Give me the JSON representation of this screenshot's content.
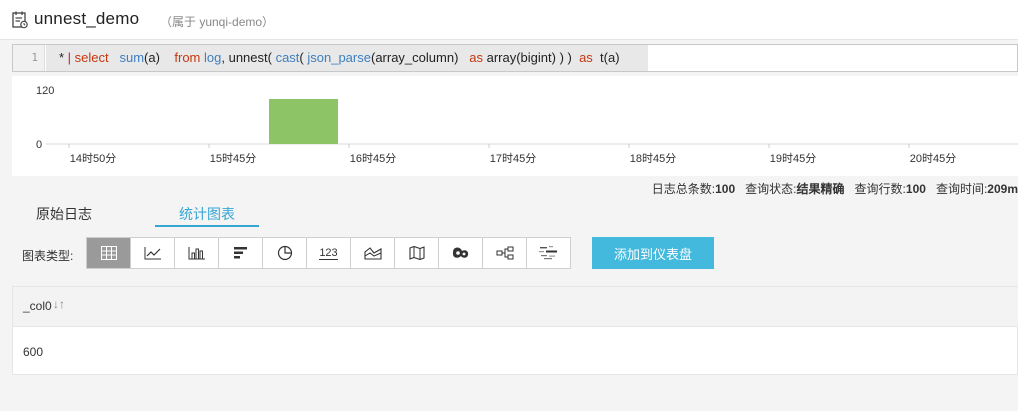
{
  "header": {
    "title": "unnest_demo",
    "project": "（属于 yunqi-demo）"
  },
  "query": {
    "line_number": "1",
    "tokens": [
      {
        "t": "* ",
        "c": "k-dark"
      },
      {
        "t": "| ",
        "c": "k-sep"
      },
      {
        "t": "select",
        "c": "k-kw"
      },
      {
        "t": "   ",
        "c": "k-plain"
      },
      {
        "t": "sum",
        "c": "k-fn"
      },
      {
        "t": "(a)",
        "c": "k-dark"
      },
      {
        "t": "    ",
        "c": "k-plain"
      },
      {
        "t": "from",
        "c": "k-kw"
      },
      {
        "t": " ",
        "c": "k-plain"
      },
      {
        "t": "log",
        "c": "k-fn"
      },
      {
        "t": ", unnest( ",
        "c": "k-dark"
      },
      {
        "t": "cast",
        "c": "k-fn"
      },
      {
        "t": "( ",
        "c": "k-dark"
      },
      {
        "t": "json_parse",
        "c": "k-fn"
      },
      {
        "t": "(array_column)",
        "c": "k-dark"
      },
      {
        "t": "   ",
        "c": "k-plain"
      },
      {
        "t": "as",
        "c": "k-kw"
      },
      {
        "t": " array(bigint) ) )  ",
        "c": "k-dark"
      },
      {
        "t": "as",
        "c": "k-kw"
      },
      {
        "t": "  t(a)",
        "c": "k-dark"
      }
    ]
  },
  "histogram": {
    "y_ticks": [
      "120",
      "0"
    ],
    "x_ticks": [
      "14时50分",
      "15时45分",
      "16时45分",
      "17时45分",
      "18时45分",
      "19时45分",
      "20时45分"
    ],
    "bar_color": "#8dc466"
  },
  "chart_data": {
    "type": "bar",
    "categories": [
      "14时50分",
      "15时45分",
      "16时45分",
      "17时45分",
      "18时45分",
      "19时45分",
      "20时45分"
    ],
    "ylim": [
      0,
      120
    ],
    "bars": [
      {
        "start": "15时45分+",
        "value": 100
      }
    ]
  },
  "summary": {
    "total_label": "日志总条数:",
    "total_value": "100",
    "status_label": "查询状态:",
    "status_value": "结果精确",
    "rows_label": "查询行数:",
    "rows_value": "100",
    "time_label": "查询时间:",
    "time_value": "209m"
  },
  "tabs": {
    "raw": "原始日志",
    "stats": "统计图表"
  },
  "toolbar": {
    "chart_type_label": "图表类型:",
    "add_button": "添加到仪表盘",
    "buttons": [
      {
        "name": "table-icon",
        "active": true
      },
      {
        "name": "line-chart-icon"
      },
      {
        "name": "column-chart-icon"
      },
      {
        "name": "bar-chart-icon"
      },
      {
        "name": "pie-chart-icon"
      },
      {
        "name": "number-icon",
        "label": "123"
      },
      {
        "name": "area-chart-icon"
      },
      {
        "name": "map-icon"
      },
      {
        "name": "heat-map-icon"
      },
      {
        "name": "flow-chart-icon"
      },
      {
        "name": "word-cloud-icon"
      }
    ]
  },
  "table": {
    "column": "_col0",
    "sort_glyph": "↓↑",
    "rows": [
      [
        "600"
      ]
    ]
  }
}
